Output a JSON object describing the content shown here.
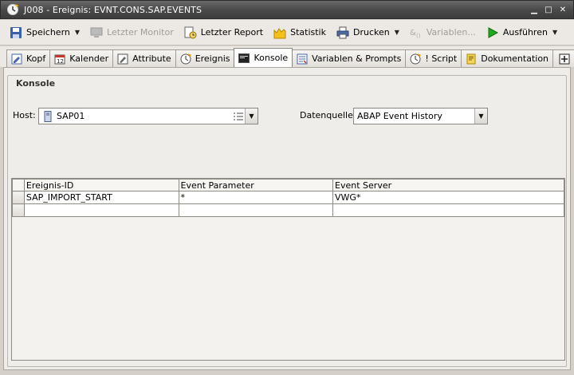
{
  "window": {
    "title": "J008 - Ereignis: EVNT.CONS.SAP.EVENTS"
  },
  "toolbar": {
    "save": "Speichern",
    "last_monitor": "Letzter Monitor",
    "last_report": "Letzter Report",
    "statistics": "Statistik",
    "print": "Drucken",
    "variables": "Variablen...",
    "execute": "Ausführen"
  },
  "tabs": [
    {
      "label": "Kopf",
      "icon": "header-icon"
    },
    {
      "label": "Kalender",
      "icon": "calendar-icon"
    },
    {
      "label": "Attribute",
      "icon": "attributes-icon"
    },
    {
      "label": "Ereignis",
      "icon": "event-clock-icon"
    },
    {
      "label": "Konsole",
      "icon": "console-icon",
      "active": true
    },
    {
      "label": "Variablen & Prompts",
      "icon": "variables-icon"
    },
    {
      "label": "! Script",
      "icon": "script-icon"
    },
    {
      "label": "Dokumentation",
      "icon": "documentation-icon"
    }
  ],
  "console": {
    "group_title": "Konsole",
    "host_label": "Host:",
    "host_value": "SAP01",
    "datasource_label": "Datenquelle:",
    "datasource_value": "ABAP Event History"
  },
  "grid": {
    "columns": [
      "Ereignis-ID",
      "Event Parameter",
      "Event Server"
    ],
    "rows": [
      [
        "SAP_IMPORT_START",
        "*",
        "VWG*"
      ],
      [
        "",
        "",
        ""
      ]
    ]
  }
}
